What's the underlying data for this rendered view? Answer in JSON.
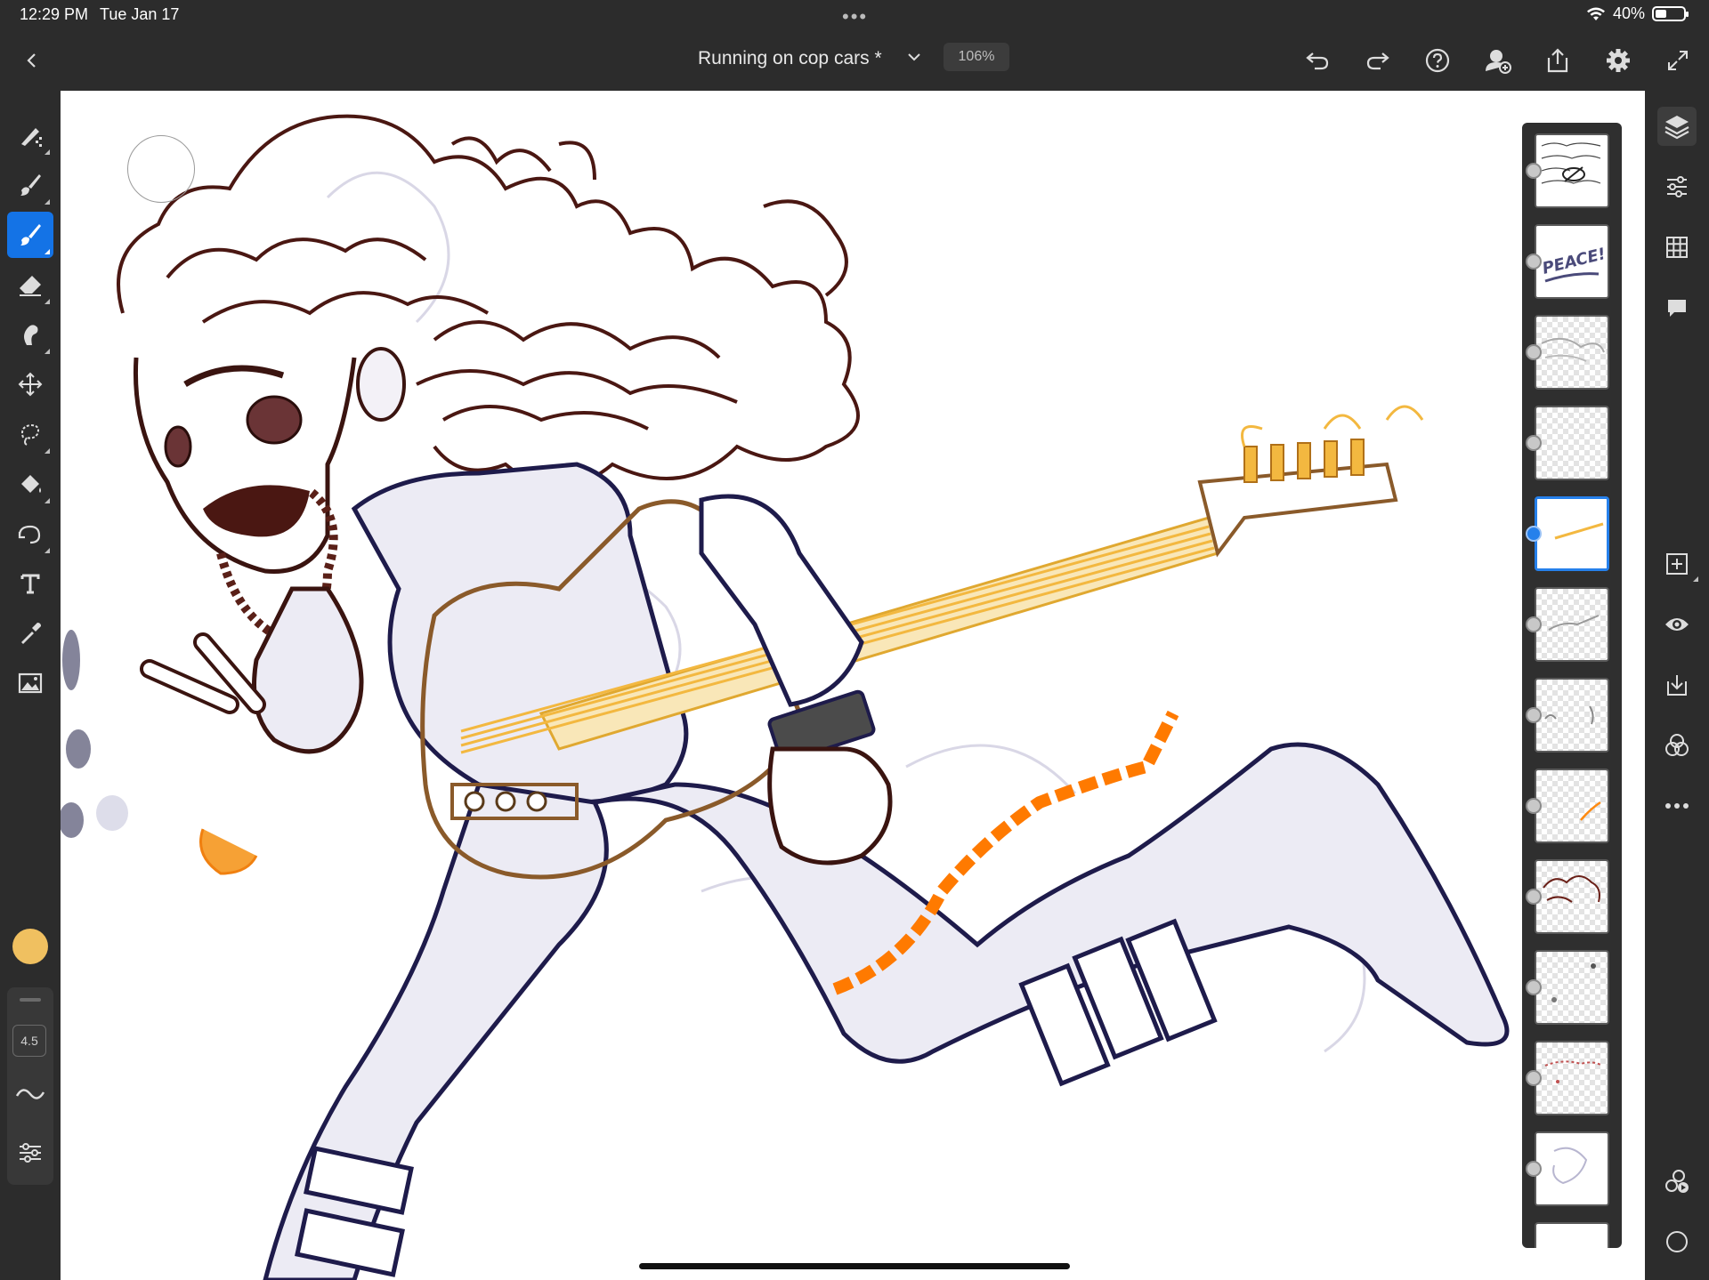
{
  "status_bar": {
    "time": "12:29 PM",
    "date": "Tue Jan 17",
    "battery": "40%",
    "battery_level": 0.4
  },
  "top_bar": {
    "document_title": "Running on cop cars *",
    "zoom": "106%",
    "icons": [
      "back-icon",
      "chevron-down-icon",
      "undo-icon",
      "redo-icon",
      "help-icon",
      "invite-icon",
      "share-icon",
      "settings-icon",
      "fullscreen-icon"
    ]
  },
  "left_toolbar": {
    "tools": [
      "pixel-brush-icon",
      "live-brush-icon",
      "vector-brush-icon",
      "eraser-icon",
      "smudge-icon",
      "transform-icon",
      "lasso-icon",
      "fill-icon",
      "shape-icon",
      "text-icon",
      "eyedropper-icon",
      "image-icon"
    ],
    "active_tool": "vector-brush-icon",
    "color": "#f0c060",
    "brush_size": "4.5"
  },
  "layers_panel": {
    "layer_count": 13,
    "active_layer_index": 4,
    "layer_contents": [
      "thumbnail sketch text",
      "PEACE!",
      "sketch",
      "empty",
      "guitar strings",
      "sketch lines",
      "small marks",
      "orange stroke",
      "hair",
      "dots",
      "red marks",
      "figure sketch",
      "white"
    ],
    "first_layer_hidden": true
  },
  "right_toolbar": {
    "icons": [
      "layers-icon",
      "properties-icon",
      "grid-icon",
      "comment-icon",
      "add-layer-icon",
      "visibility-icon",
      "import-icon",
      "blend-icon",
      "more-icon",
      "timelapse-icon",
      "circle-icon"
    ]
  },
  "accent_color": "#1473e6"
}
